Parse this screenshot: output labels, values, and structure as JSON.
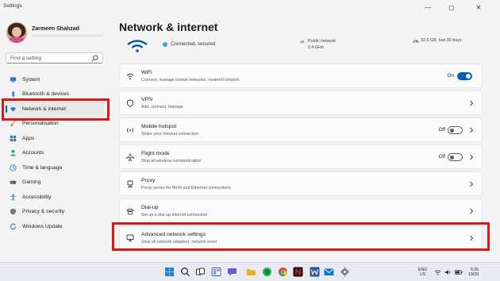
{
  "window": {
    "title": "Settings"
  },
  "user": {
    "name": "Zarmeen Shahzad"
  },
  "search": {
    "placeholder": "Find a setting"
  },
  "nav": {
    "items": [
      {
        "label": "System",
        "icon": "monitor-icon",
        "color": "#2b79d0"
      },
      {
        "label": "Bluetooth & devices",
        "icon": "bluetooth-icon",
        "color": "#2b79d0"
      },
      {
        "label": "Network & internet",
        "icon": "wifi-icon",
        "color": "#2b79d0",
        "active": true
      },
      {
        "label": "Personalisation",
        "icon": "brush-icon",
        "color": "#c98a2b"
      },
      {
        "label": "Apps",
        "icon": "apps-icon",
        "color": "#4a6aa8"
      },
      {
        "label": "Accounts",
        "icon": "person-icon",
        "color": "#2fa36b"
      },
      {
        "label": "Time & language",
        "icon": "globe-clock-icon",
        "color": "#2b79d0"
      },
      {
        "label": "Gaming",
        "icon": "gamepad-icon",
        "color": "#555555"
      },
      {
        "label": "Accessibility",
        "icon": "accessibility-icon",
        "color": "#2b79d0"
      },
      {
        "label": "Privacy & security",
        "icon": "shield-icon",
        "color": "#666666"
      },
      {
        "label": "Windows Update",
        "icon": "update-icon",
        "color": "#2b79d0"
      }
    ]
  },
  "main": {
    "title": "Network & internet",
    "status": {
      "connection": "Connected, secured",
      "network_type": "Public network",
      "band": "2.4 GHz",
      "usage": "32.6 GB, last 30 days"
    },
    "cards": [
      {
        "title": "WiFi",
        "subtitle": "Connect, manage known networks, metered network",
        "icon": "wifi-icon",
        "control": "toggle",
        "state": "On"
      },
      {
        "title": "VPN",
        "subtitle": "Add, connect, manage",
        "icon": "vpn-shield-icon",
        "control": "chevron"
      },
      {
        "title": "Mobile hotspot",
        "subtitle": "Share your internet connection",
        "icon": "hotspot-icon",
        "control": "toggle-chevron",
        "state": "Off"
      },
      {
        "title": "Flight mode",
        "subtitle": "Stop all wireless communication",
        "icon": "airplane-icon",
        "control": "toggle-chevron",
        "state": "Off"
      },
      {
        "title": "Proxy",
        "subtitle": "Proxy server for Wi-Fi and Ethernet connections",
        "icon": "proxy-icon",
        "control": "chevron"
      },
      {
        "title": "Dial-up",
        "subtitle": "Set up a dial-up internet connection",
        "icon": "dialup-icon",
        "control": "chevron"
      },
      {
        "title": "Advanced network settings",
        "subtitle": "View all network adapters, network reset",
        "icon": "monitor-network-icon",
        "control": "chevron"
      }
    ]
  },
  "taskbar": {
    "icons": [
      {
        "name": "start-icon",
        "color": "#1e7fd6"
      },
      {
        "name": "search-icon",
        "color": "#333333"
      },
      {
        "name": "task-view-icon",
        "color": "#333333"
      },
      {
        "name": "chat-icon",
        "color": "#6b5ac9"
      },
      {
        "name": "file-explorer-icon",
        "color": "#e9b422"
      },
      {
        "name": "spotify-icon",
        "color": "#1db954"
      },
      {
        "name": "chrome-icon",
        "color": "#e44134"
      },
      {
        "name": "whatsapp-icon",
        "color": "#25d366"
      },
      {
        "name": "netflix-icon",
        "color": "#d81f26"
      },
      {
        "name": "word-icon",
        "color": "#2b579a"
      },
      {
        "name": "mail-icon",
        "color": "#0078d4"
      },
      {
        "name": "settings-icon",
        "color": "#6d7a8a"
      }
    ],
    "lang": "ENG",
    "region": "US",
    "time": "6:35",
    "date": "10/29"
  }
}
